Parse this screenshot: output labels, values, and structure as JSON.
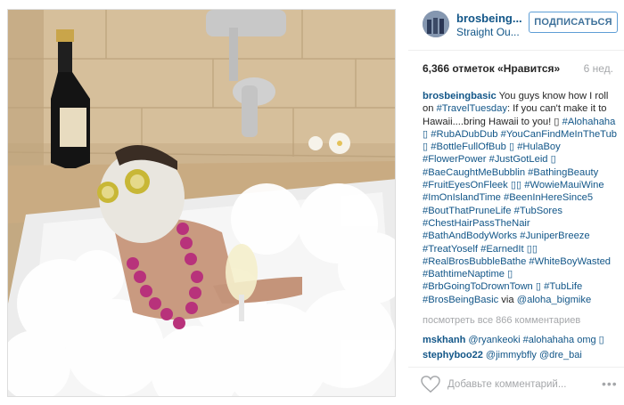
{
  "post": {
    "username": "brosbeing...",
    "location": "Straight Ou...",
    "follow_label": "ПОДПИСАТЬСЯ",
    "likes": "6,366 отметок «Нравится»",
    "age": "6 нед."
  },
  "caption": {
    "username": "brosbeingbasic",
    "text": " You guys know how I roll on ",
    "tag1": "#TravelTuesday",
    "text2": ": If you can't make it to Hawaii....bring Hawaii to you! ▯ ",
    "tags_line": "#Alohahaha ▯ #RubADubDub #YouCanFindMeInTheTub ▯ #BottleFullOfBub ▯ #HulaBoy #FlowerPower #JustGotLeid ▯ #BaeCaughtMeBubblin #BathingBeauty #FruitEyesOnFleek ▯▯ #WowieMauiWine #ImOnIslandTime #BeenInHereSince5 #BoutThatPruneLife #TubSores #ChestHairPassTheNair #BathAndBodyWorks #JuniperBreeze #TreatYoself #EarnedIt ▯▯ #RealBrosBubbleBathe #WhiteBoyWasted #BathtimeNaptime ▯ #BrbGoingToDrownTown ▯ #TubLife #BrosBeingBasic",
    "via": " via ",
    "via_user": "@aloha_bigmike"
  },
  "comments": {
    "view_all": "посмотреть все 866 комментариев",
    "c1_user": "mskhanh",
    "c1_text": " @ryankeoki #alohahaha omg ▯",
    "c2_user": "stephyboo22",
    "c2_text": " @jimmybfly @dre_bai"
  },
  "footer": {
    "placeholder": "Добавьте комментарий...",
    "more": "•••"
  },
  "icons": {
    "heart": "heart-icon",
    "more": "more-icon"
  },
  "colors": {
    "link": "#125688",
    "follow_border": "#5e9ed6",
    "muted": "#a5a7aa"
  }
}
